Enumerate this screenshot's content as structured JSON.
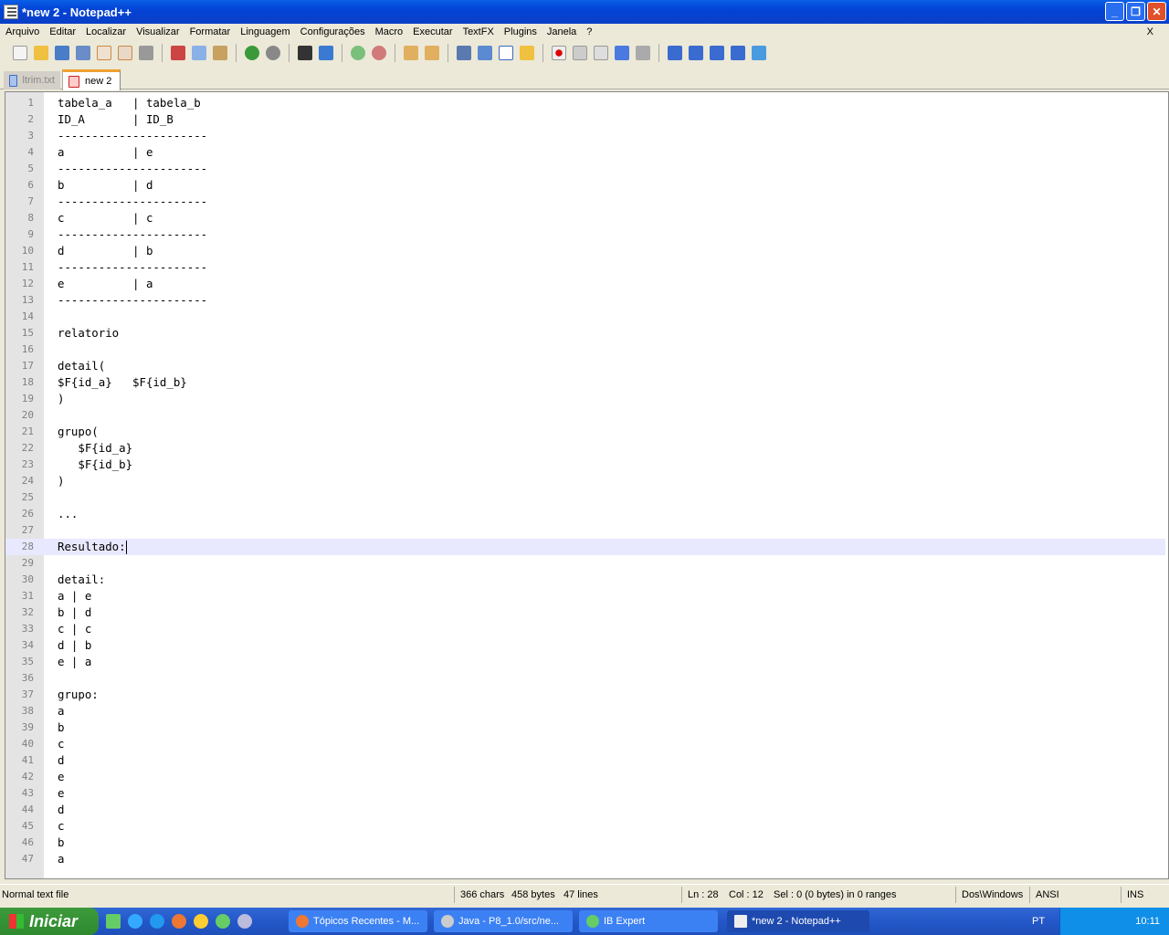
{
  "window": {
    "title": "*new  2 - Notepad++",
    "min": "_",
    "max": "❐",
    "close": "✕"
  },
  "menu": [
    "Arquivo",
    "Editar",
    "Localizar",
    "Visualizar",
    "Formatar",
    "Linguagem",
    "Configurações",
    "Macro",
    "Executar",
    "TextFX",
    "Plugins",
    "Janela",
    "?"
  ],
  "menu_close": "X",
  "tabs": [
    {
      "label": "ltrim.txt"
    },
    {
      "label": "new  2"
    }
  ],
  "lines": [
    "tabela_a   | tabela_b",
    "ID_A       | ID_B",
    "----------------------",
    "a          | e",
    "----------------------",
    "b          | d",
    "----------------------",
    "c          | c",
    "----------------------",
    "d          | b",
    "----------------------",
    "e          | a",
    "----------------------",
    "",
    "relatorio",
    "",
    "detail(",
    "$F{id_a}   $F{id_b}",
    ")",
    "",
    "grupo(",
    "   $F{id_a}",
    "   $F{id_b}",
    ")",
    "",
    "...",
    "",
    "Resultado:",
    "",
    "detail:",
    "a | e",
    "b | d",
    "c | c",
    "d | b",
    "e | a",
    "",
    "grupo:",
    "a",
    "b",
    "c",
    "d",
    "e",
    "e",
    "d",
    "c",
    "b",
    "a"
  ],
  "current_line": 28,
  "status": {
    "type": "Normal text file",
    "chars": "366 chars",
    "bytes": "458 bytes",
    "lines": "47 lines",
    "ln": "Ln : 28",
    "col": "Col : 12",
    "sel": "Sel : 0 (0 bytes) in 0 ranges",
    "eol": "Dos\\Windows",
    "enc": "ANSI",
    "mode": "INS"
  },
  "taskbar": {
    "start": "Iniciar",
    "tasks": [
      "Tópicos Recentes - M...",
      "Java - P8_1.0/src/ne...",
      "IB Expert",
      "*new  2 - Notepad++"
    ],
    "lang": "PT",
    "clock": "10:11"
  }
}
